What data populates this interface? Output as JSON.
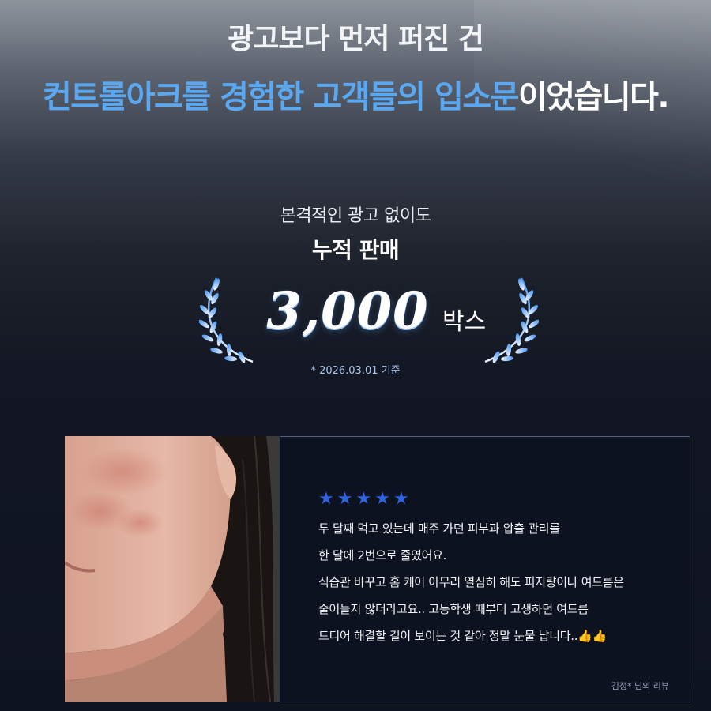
{
  "header": {
    "line1": "광고보다 먼저 퍼진 건",
    "line2_highlight": "컨트롤아크를 경험한 고객들의 입소문",
    "line2_rest": "이었습니다."
  },
  "stats": {
    "subtitle": "본격적인 광고 없이도",
    "label": "누적 판매",
    "value": "3,000",
    "unit": "박스",
    "footnote": "* 2026.03.01 기준"
  },
  "review": {
    "stars": [
      "★",
      "★",
      "★",
      "★",
      "★"
    ],
    "lines": [
      "두 달째 먹고 있는데 매주 가던 피부과 압출 관리를",
      "한 달에 2번으로 줄였어요.",
      "식습관 바꾸고 홈 케어 아무리 열심히 해도 피지량이나 여드름은",
      "줄어들지 않더라고요..  고등학생 때부터 고생하던 여드름",
      "드디어 해결할 길이 보이는 것 같아 정말 눈물 납니다.."
    ],
    "emoji": "👍👍",
    "reviewer": "김정* 님의 리뷰"
  },
  "colors": {
    "highlight": "#5aa8f2",
    "star": "#2f62e0",
    "border": "#56607a"
  },
  "icons": [
    "laurel-left-icon",
    "laurel-right-icon",
    "star-icon",
    "thumbs-up-icon"
  ]
}
